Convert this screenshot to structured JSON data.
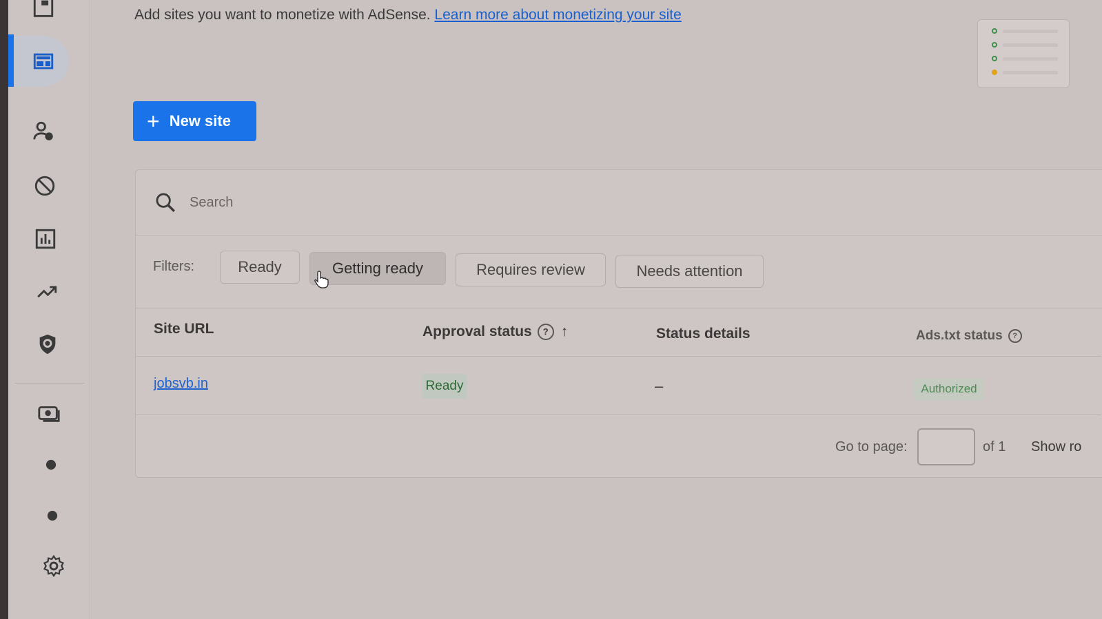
{
  "header": {
    "intro_text": "Add sites you want to monetize with AdSense.",
    "learn_more_link": "Learn more about monetizing your site"
  },
  "actions": {
    "new_site_label": "New site"
  },
  "search": {
    "placeholder": "Search"
  },
  "filters": {
    "label": "Filters:",
    "chips": [
      "Ready",
      "Getting ready",
      "Requires review",
      "Needs attention"
    ],
    "hovered": "Getting ready"
  },
  "table": {
    "columns": {
      "site_url": "Site URL",
      "approval_status": "Approval status",
      "status_details": "Status details",
      "ads_txt_status": "Ads.txt status"
    },
    "sort_column": "Approval status",
    "sort_direction": "ascending",
    "rows": [
      {
        "site_url": "jobsvb.in",
        "approval_status": "Ready",
        "status_details": "–",
        "ads_txt_status": "Authorized"
      }
    ]
  },
  "pagination": {
    "go_to_label": "Go to page:",
    "page_value": "",
    "of_total": "of 1",
    "show_rows_label": "Show ro"
  },
  "sidebar": {
    "icons": [
      "sites-icon",
      "user-account-icon",
      "block-icon",
      "reports-icon",
      "trending-icon",
      "policy-shield-icon",
      "payments-icon",
      "dot-icon",
      "dot-icon",
      "settings-icon"
    ],
    "active": "sites-icon"
  },
  "colors": {
    "accent": "#1a73e8",
    "success_text": "#2b6a35",
    "link": "#1f62cf"
  }
}
